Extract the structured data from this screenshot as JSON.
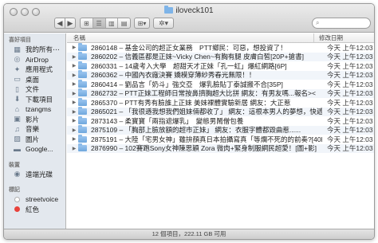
{
  "window": {
    "title": "iloveck101"
  },
  "toolbar": {
    "back": "◀",
    "forward": "▶",
    "views": [
      "⊞",
      "☰",
      "▥",
      "▤"
    ],
    "arrange": "⊞▾",
    "action": "✲▾",
    "search_icon": "⌕"
  },
  "sidebar": {
    "favorites_label": "喜好項目",
    "favorites": [
      {
        "label": "我的所有⋯",
        "icon": "all-files-icon"
      },
      {
        "label": "AirDrop",
        "icon": "airdrop-icon"
      },
      {
        "label": "應用程式",
        "icon": "applications-icon"
      },
      {
        "label": "桌面",
        "icon": "desktop-icon"
      },
      {
        "label": "文件",
        "icon": "documents-icon"
      },
      {
        "label": "下載項目",
        "icon": "downloads-icon"
      },
      {
        "label": "tzangms",
        "icon": "home-icon"
      },
      {
        "label": "影片",
        "icon": "movies-icon"
      },
      {
        "label": "音樂",
        "icon": "music-icon"
      },
      {
        "label": "圖片",
        "icon": "pictures-icon"
      },
      {
        "label": "Google...",
        "icon": "folder-icon"
      }
    ],
    "devices_label": "裝置",
    "devices": [
      {
        "label": "遠端光碟",
        "icon": "disc-icon"
      }
    ],
    "tags_label": "標記",
    "tags": [
      {
        "label": "streetvoice",
        "color": "#d9d9d9"
      },
      {
        "label": "紅色",
        "color": "#e8423b"
      }
    ]
  },
  "columns": {
    "name": "名稱",
    "date": "修改日期"
  },
  "files": [
    {
      "name": "2860148 – 基金公司的超正女業務　PTT鄉民：可惡，想投資了！",
      "date": "今天 上午12:03"
    },
    {
      "name": "2860202 – 信義區都是正妹~Vicky Chen~有胸有腿 皮膚白皙[20P+搶書]",
      "date": "今天 上午12:03"
    },
    {
      "name": "2860331 – 14歲考入大學　超甜天才正妹「孔一虹」爆紅網路[6P]",
      "date": "今天 上午12:03"
    },
    {
      "name": "2860362 – 中國內衣廠決賽 嬌模穿薄紗秀春光無限！！",
      "date": "今天 上午12:03"
    },
    {
      "name": "2860414 – 劉品言「奶斗」強交亞　爆乳臉貼丁泰誠搬不合[35P]",
      "date": "今天 上午12:03"
    },
    {
      "name": "2862732 – PTT正妹工程師日常按鼻擠胸超大比拼 網友：有男友嗎...報名>< ",
      "date": "今天 上午12:03"
    },
    {
      "name": "2865370 – PTT有秀有臉誰上正妹 美妹裸體實驗新居 網友：大正惹",
      "date": "今天 上午12:03"
    },
    {
      "name": "2865021 – 「我很遜我想我們姐妹倆都收了」 網友：這根本男人的夢想，快遞我！",
      "date": "今天 上午12:03"
    },
    {
      "name": "2873143 – 柔寶寶「兩指遮爆乳」　變態男鬧僧包養",
      "date": "今天 上午12:03"
    },
    {
      "name": "2875109 – 「胸部上臉放額的超市正妹」 網友：衣服字體都毀曲惹......",
      "date": "今天 上午12:03"
    },
    {
      "name": "2875191 – 大陸「宅男女神」雖拚顏真日本拍攝寫真「等爛不死的的前奏?[40P]",
      "date": "今天 上午12:03"
    },
    {
      "name": "2876990 – 102賽跑Sony女神陳思穎 Zora 微肉+緊身制服網民超愛！[圖+影]",
      "date": "今天 上午12:03"
    }
  ],
  "status": "12 個項目，222.11 GB 可用"
}
